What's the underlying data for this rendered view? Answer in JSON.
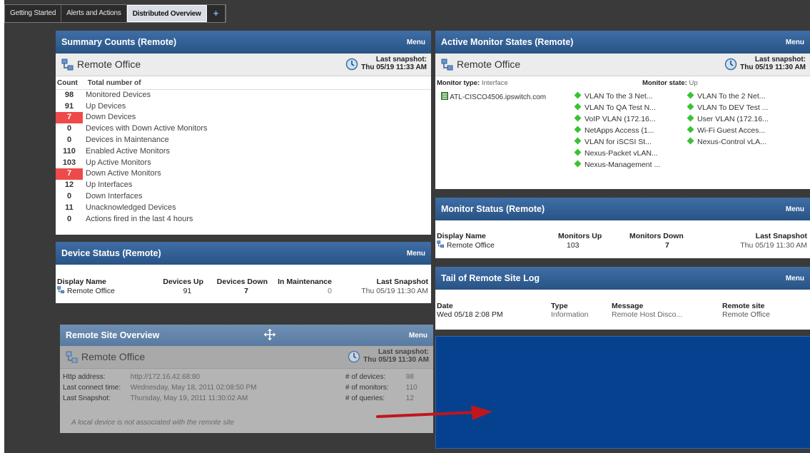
{
  "tabs": [
    {
      "label": "Getting Started",
      "active": false
    },
    {
      "label": "Alerts and Actions",
      "active": false
    },
    {
      "label": "Distributed Overview",
      "active": true
    }
  ],
  "tab_add": "+",
  "menu_label": "Menu",
  "remote_office": "Remote Office",
  "summary": {
    "title": "Summary Counts (Remote)",
    "snapshot_label": "Last snapshot:",
    "snapshot_time": "Thu 05/19 11:33 AM",
    "col_count": "Count",
    "col_total": "Total number of",
    "rows": [
      {
        "count": "98",
        "label": "Monitored Devices",
        "alert": false
      },
      {
        "count": "91",
        "label": "Up Devices",
        "alert": false
      },
      {
        "count": "7",
        "label": "Down Devices",
        "alert": true
      },
      {
        "count": "0",
        "label": "Devices with Down Active Monitors",
        "alert": false
      },
      {
        "count": "0",
        "label": "Devices in Maintenance",
        "alert": false
      },
      {
        "count": "110",
        "label": "Enabled Active Monitors",
        "alert": false
      },
      {
        "count": "103",
        "label": "Up Active Monitors",
        "alert": false
      },
      {
        "count": "7",
        "label": "Down Active Monitors",
        "alert": true
      },
      {
        "count": "12",
        "label": "Up Interfaces",
        "alert": false
      },
      {
        "count": "0",
        "label": "Down Interfaces",
        "alert": false
      },
      {
        "count": "11",
        "label": "Unacknowledged Devices",
        "alert": false
      },
      {
        "count": "0",
        "label": "Actions fired in the last 4 hours",
        "alert": false
      }
    ]
  },
  "device_status": {
    "title": "Device Status (Remote)",
    "headers": [
      "Display Name",
      "Devices Up",
      "Devices Down",
      "In Maintenance",
      "Last Snapshot"
    ],
    "row": [
      "Remote Office",
      "91",
      "7",
      "0",
      "Thu 05/19 11:30 AM"
    ]
  },
  "remote_overview": {
    "title": "Remote Site Overview",
    "snapshot_label": "Last snapshot:",
    "snapshot_time": "Thu 05/19 11:30 AM",
    "http_label": "Http address:",
    "http_value": "http://172.16.42.68:80",
    "connect_label": "Last connect time:",
    "connect_value": "Wednesday, May 18, 2011 02:08:50 PM",
    "snap_label": "Last Snapshot:",
    "snap_value": "Thursday, May 19, 2011 11:30:02 AM",
    "devices_label": "# of devices:",
    "devices_value": "98",
    "monitors_label": "# of monitors:",
    "monitors_value": "110",
    "queries_label": "# of queries:",
    "queries_value": "12",
    "note": "A local device is not associated with the remote site"
  },
  "active_monitor": {
    "title": "Active Monitor States (Remote)",
    "snapshot_label": "Last snapshot:",
    "snapshot_time": "Thu 05/19 11:30 AM",
    "type_label": "Monitor type:",
    "type_value": "Interface",
    "state_label": "Monitor state:",
    "state_value": "Up",
    "device": "ATL-CISCO4506.ipswitch.com",
    "col1": [
      "VLAN To the 3 Net...",
      "VLAN To QA Test N...",
      "VoIP VLAN (172.16...",
      "NetApps Access (1...",
      "VLAN for iSCSI St...",
      "Nexus-Packet vLAN...",
      "Nexus-Management ..."
    ],
    "col2": [
      "VLAN To the 2 Net...",
      "VLAN To DEV Test ...",
      "User VLAN (172.16...",
      "Wi-Fi Guest Acces...",
      "Nexus-Control vLA..."
    ]
  },
  "monitor_status": {
    "title": "Monitor Status (Remote)",
    "headers": [
      "Display Name",
      "Monitors Up",
      "Monitors Down",
      "Last Snapshot"
    ],
    "row": [
      "Remote Office",
      "103",
      "7",
      "Thu 05/19 11:30 AM"
    ]
  },
  "tail_log": {
    "title": "Tail of Remote Site Log",
    "headers": [
      "Date",
      "Type",
      "Message",
      "Remote site"
    ],
    "row": [
      "Wed 05/18 2:08 PM",
      "Information",
      "Remote Host Disco...",
      "Remote Office"
    ]
  },
  "colors": {
    "header_blue": "#3f6ea6",
    "alert_red": "#ee4a4a",
    "status_green": "#39c234",
    "empty_panel_blue": "#06418f",
    "annotation_arrow": "#c0161c"
  }
}
